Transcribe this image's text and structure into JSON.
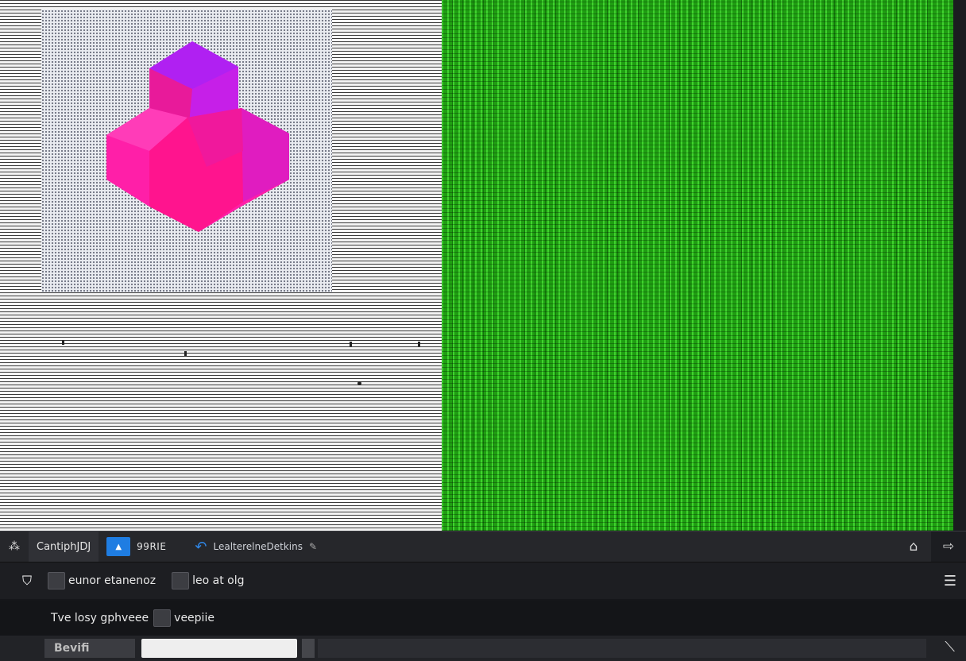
{
  "toolbar": {
    "app_icon": "nodes-icon",
    "title": "CantiphJDJ",
    "blue_button_glyph": "▲",
    "code_label": "99RIE",
    "link_label": "LealterelneDetkins",
    "link_icon": "undo-arrow-icon",
    "right_icons": [
      "home-icon",
      "forward-arrow-icon"
    ]
  },
  "options": {
    "row1": [
      {
        "label": "eunor etanenoz"
      },
      {
        "label": "leo at olg"
      }
    ],
    "row2": [
      {
        "label": "Tve losy gphveee"
      },
      {
        "label": "veepiie"
      }
    ]
  },
  "bottom": {
    "button_label": "Bevifi",
    "field_value": ""
  },
  "colors": {
    "accent": "#1f7de2",
    "green_pane": "#1f9e12",
    "shape_magenta": "#ff1fa8",
    "shape_violet": "#b620f0"
  }
}
